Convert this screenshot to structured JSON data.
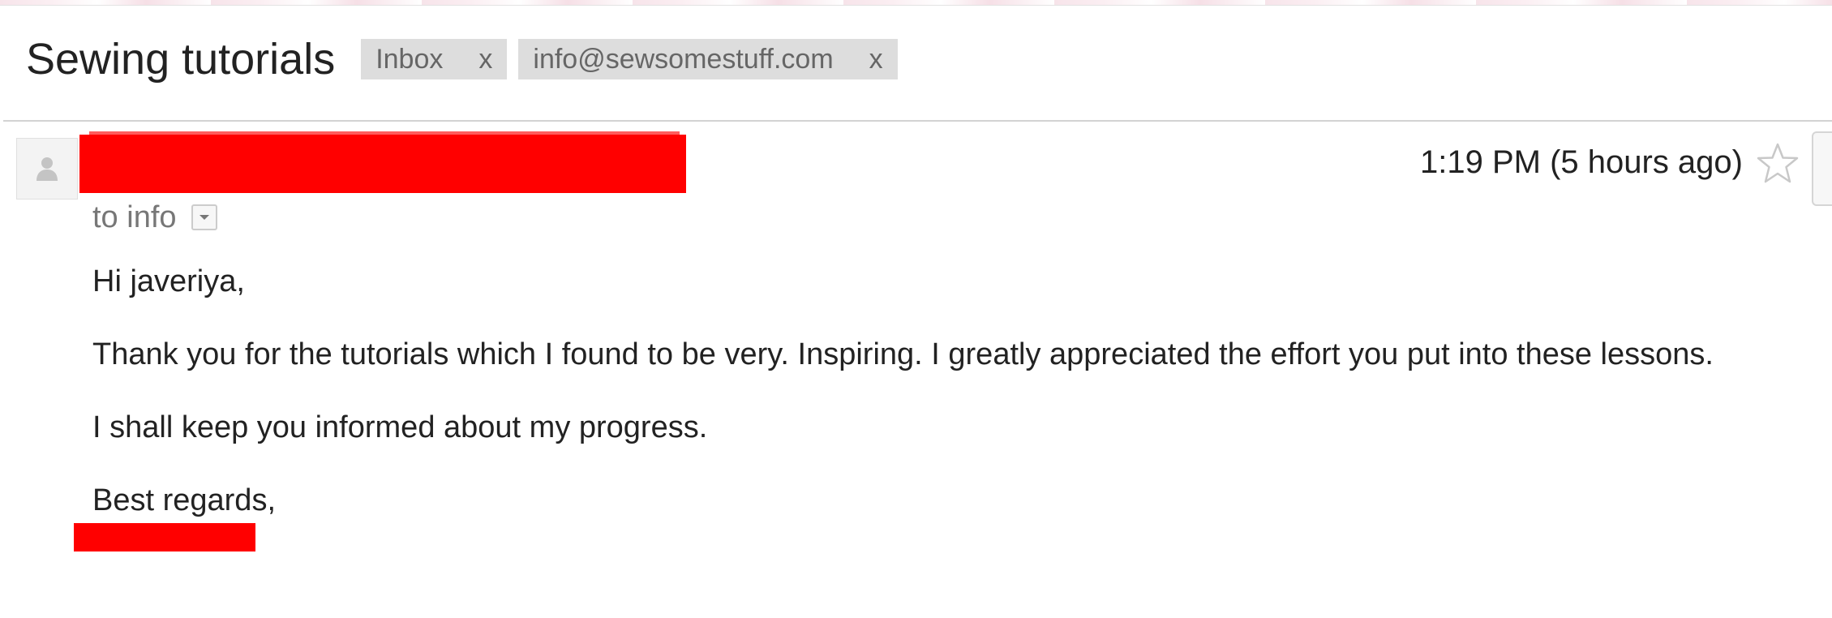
{
  "thread": {
    "subject": "Sewing tutorials",
    "labels": [
      {
        "name": "Inbox",
        "remove": "x"
      },
      {
        "name": "info@sewsomestuff.com",
        "remove": "x"
      }
    ]
  },
  "message": {
    "sender": "",
    "timestamp": "1:19 PM (5 hours ago)",
    "recipient": "to info",
    "body": {
      "greeting": "Hi javeriya,",
      "paragraph1": "Thank you for the tutorials which I found to be very. Inspiring. I greatly appreciated the effort you put into these lessons.",
      "paragraph2": "I shall keep you informed about my progress.",
      "closing": "Best regards,"
    }
  },
  "icons": {
    "avatar": "person-icon",
    "star": "star-icon",
    "details": "dropdown-arrow-icon"
  },
  "colors": {
    "redaction": "#ff0000",
    "chip_background": "#dddddd",
    "muted_text": "#777777"
  }
}
